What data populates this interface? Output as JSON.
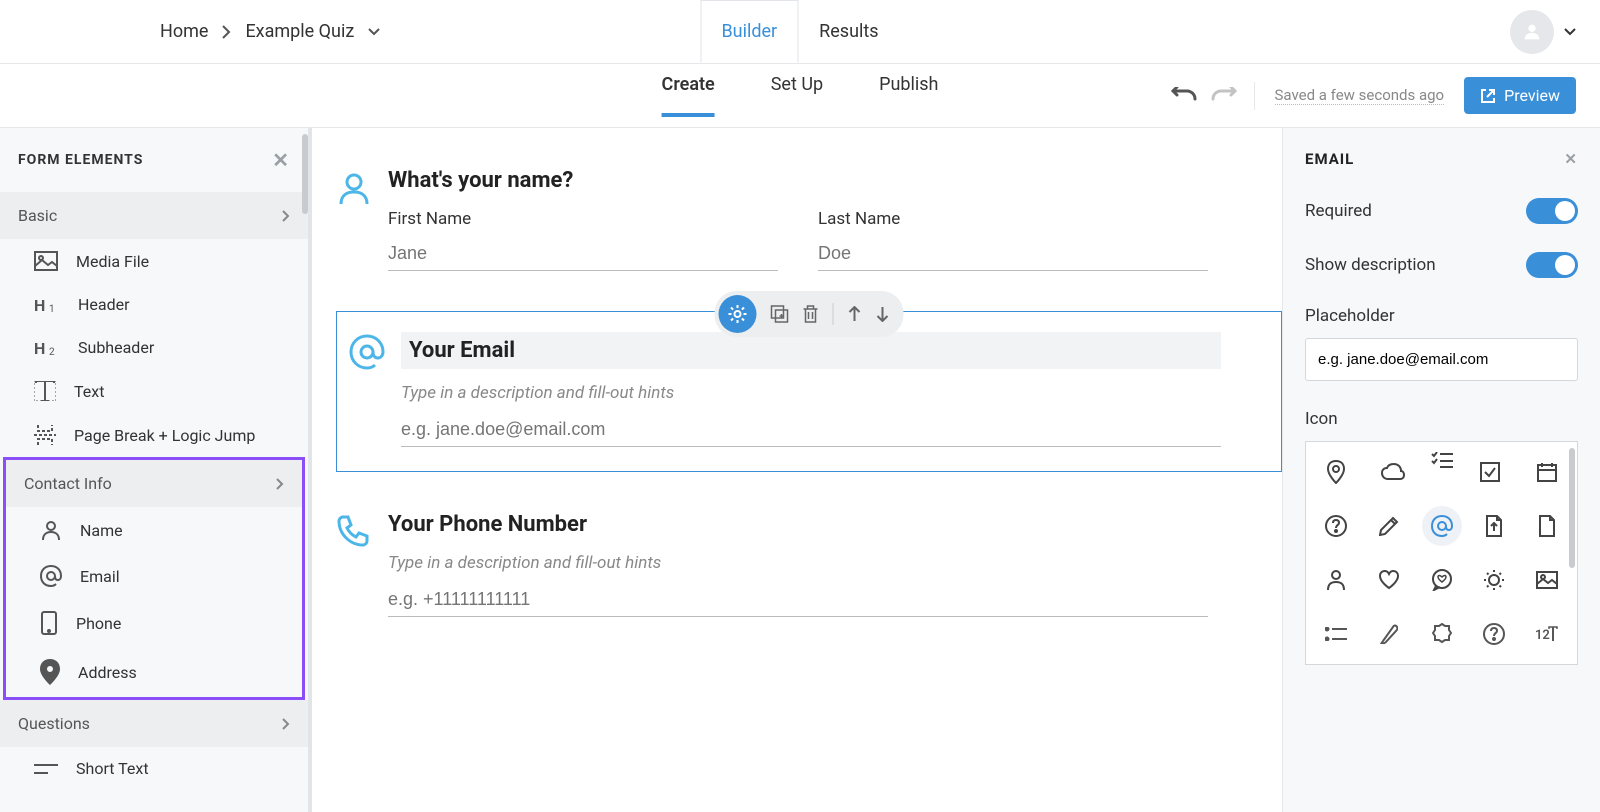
{
  "header": {
    "breadcrumb_home": "Home",
    "breadcrumb_quiz": "Example Quiz",
    "tab_builder": "Builder",
    "tab_results": "Results"
  },
  "subnav": {
    "create": "Create",
    "setup": "Set Up",
    "publish": "Publish",
    "saved": "Saved a few seconds ago",
    "preview": "Preview"
  },
  "sidebar": {
    "title": "FORM ELEMENTS",
    "groups": {
      "basic": "Basic",
      "contact": "Contact Info",
      "questions": "Questions"
    },
    "basic_items": {
      "media": "Media File",
      "header": "Header",
      "subheader": "Subheader",
      "text": "Text",
      "pagebreak": "Page Break + Logic Jump"
    },
    "contact_items": {
      "name": "Name",
      "email": "Email",
      "phone": "Phone",
      "address": "Address"
    },
    "question_items": {
      "shorttext": "Short Text"
    }
  },
  "canvas": {
    "name_q": "What's your name?",
    "first_name_label": "First Name",
    "first_name_placeholder": "Jane",
    "last_name_label": "Last Name",
    "last_name_placeholder": "Doe",
    "email_q": "Your Email",
    "desc_hint": "Type in a description and fill-out hints",
    "email_placeholder": "e.g. jane.doe@email.com",
    "phone_q": "Your Phone Number",
    "phone_placeholder": "e.g. +11111111111"
  },
  "panel": {
    "title": "EMAIL",
    "required": "Required",
    "showdesc": "Show description",
    "placeholder_label": "Placeholder",
    "placeholder_value": "e.g. jane.doe@email.com",
    "icon_label": "Icon"
  }
}
